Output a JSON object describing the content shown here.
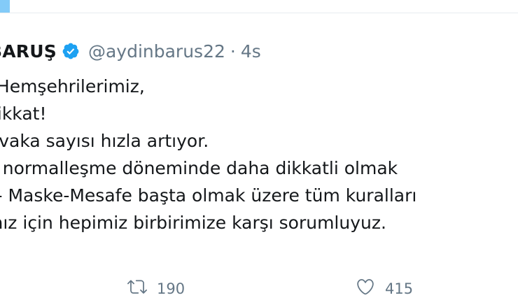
{
  "tweet": {
    "display_name": "BARUŞ",
    "handle": "@aydinbarus22",
    "separator": "·",
    "timestamp": "4s",
    "lines": [
      "i Hemşehrilerimiz,",
      "dikkat!",
      "r vaka sayısı hızla artıyor.",
      "ü normalleşme döneminde daha dikkatli olmak",
      "k- Maske-Mesafe başta olmak üzere tüm kuralları",
      "mız için hepimiz birbirimize karşı sorumluyuz."
    ],
    "retweet_count": "190",
    "like_count": "415"
  },
  "colors": {
    "accent": "#1da1f2",
    "secondary_text": "#657786",
    "primary_text": "#14171a"
  },
  "icons": [
    "verified-badge-icon",
    "retweet-icon",
    "like-icon"
  ]
}
